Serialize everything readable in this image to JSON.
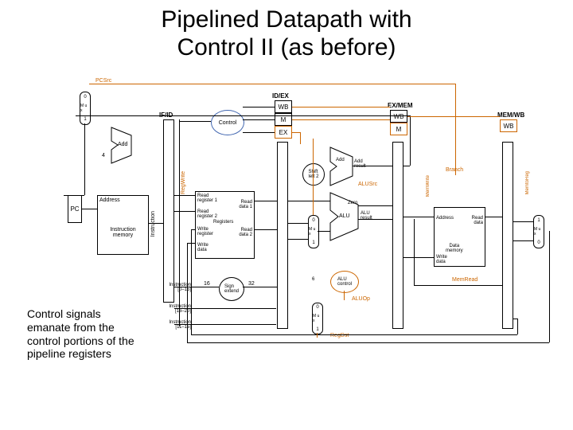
{
  "title_line1": "Pipelined Datapath with",
  "title_line2": "Control II (as before)",
  "caption": "Control signals emanate from the control portions of the pipeline registers",
  "labels": {
    "pcsrc": "PCSrc",
    "ifid": "IF/ID",
    "idex": "ID/EX",
    "exmem": "EX/MEM",
    "memwb": "MEM/WB",
    "wb1": "WB",
    "wb2": "WB",
    "wb3": "WB",
    "m1": "M",
    "m2": "M",
    "ex": "EX",
    "control": "Control",
    "add1": "Add",
    "add2": "Add",
    "add_result": "Add\nresult",
    "shiftleft": "Shift\nleft 2",
    "four": "4",
    "pc": "PC",
    "address1": "Address",
    "instr_mem": "Instruction\nmemory",
    "instruction": "Instruction",
    "regwrite": "RegWrite",
    "readreg1": "Read\nregister 1",
    "readreg2": "Read\nregister 2",
    "writereg": "Write\nregister",
    "writedata": "Write\ndata",
    "registers": "Registers",
    "readdata1": "Read\ndata 1",
    "readdata2": "Read\ndata 2",
    "signextend": "Sign\nextend",
    "sixteen": "16",
    "thirtytwo": "32",
    "instr150": "Instruction\n[15–0]",
    "instr2016": "Instruction\n[20–16]",
    "instr1511": "Instruction\n[15–11]",
    "zero": "Zero",
    "alu": "ALU",
    "aluresult": "ALU\nresult",
    "alusrc": "ALUSrc",
    "aluop": "ALUOp",
    "alucontrol": "ALU\ncontrol",
    "six": "6",
    "branch": "Branch",
    "memwrite": "MemWrite",
    "memread": "MemRead",
    "address2": "Address",
    "datamem": "Data\nmemory",
    "writedata2": "Write\ndata",
    "readdata": "Read\ndata",
    "memtoreg": "MemtoReg",
    "regdst": "RegDst",
    "mux": "M\nu\nx",
    "zero_in": "0",
    "one_in": "1"
  }
}
